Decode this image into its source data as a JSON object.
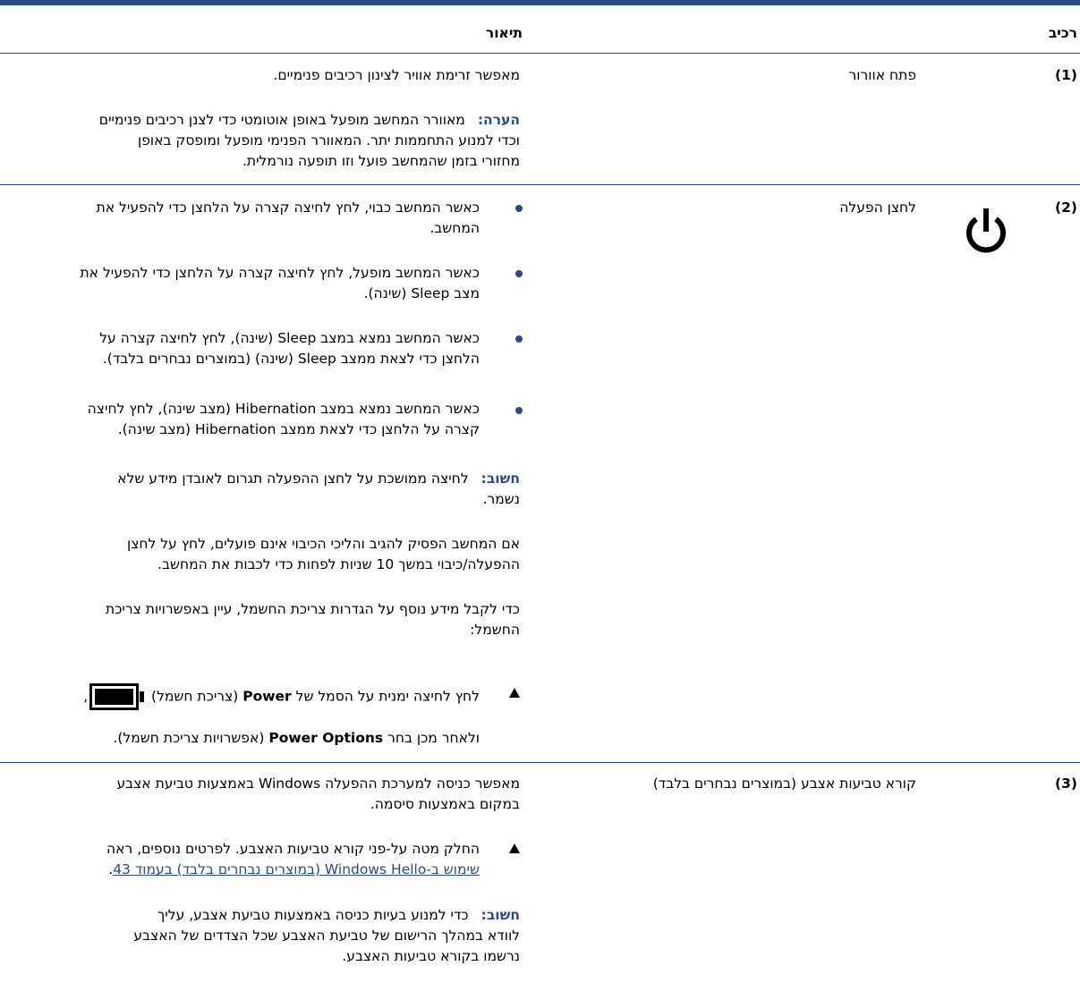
{
  "header": {
    "component": "רכיב",
    "description": "תיאור"
  },
  "rows": [
    {
      "number": "(1)",
      "name": "פתח אוורור",
      "desc": "מאפשר זרימת אוויר לצינון רכיבים פנימיים.",
      "note_label": "הערה:",
      "note_line1": "מאוורר המחשב מופעל באופן אוטומטי כדי לצנן רכיבים פנימיים",
      "note_line2": "וכדי למנוע התחממות יתר. המאוורר הפנימי מופעל ומופסק באופן",
      "note_line3": "מחזורי בזמן שהמחשב פועל וזו תופעה נורמלית."
    },
    {
      "number": "(2)",
      "name": "לחצן הפעלה",
      "icon": "power-icon",
      "bullets": [
        {
          "line1": "כאשר המחשב כבוי, לחץ לחיצה קצרה על הלחצן כדי להפעיל את",
          "line2": "המחשב."
        },
        {
          "line1": "כאשר המחשב מופעל, לחץ לחיצה קצרה על הלחצן כדי להפעיל את",
          "line2": "מצב Sleep (שינה)."
        },
        {
          "line1": "כאשר המחשב נמצא במצב Sleep (שינה), לחץ לחיצה קצרה על",
          "line2": "הלחצן כדי לצאת ממצב Sleep (שינה) (במוצרים נבחרים בלבד)."
        },
        {
          "line1": "כאשר המחשב נמצא במצב Hibernation (מצב שינה), לחץ לחיצה",
          "line2": "קצרה על הלחצן כדי לצאת ממצב Hibernation (מצב שינה)."
        }
      ],
      "important_label": "חשוב:",
      "important_line1": "לחיצה ממושכת על לחצן ההפעלה תגרום לאובדן מידע שלא",
      "important_line2": "נשמר.",
      "para1_line1": "אם המחשב הפסיק להגיב והליכי הכיבוי אינם פועלים, לחץ על לחצן",
      "para1_line2": "ההפעלה/כיבוי במשך 10 שניות לפחות כדי לכבות את המחשב.",
      "para2_line1": "כדי לקבל מידע נוסף על הגדרות צריכת החשמל, עיין באפשרויות צריכת",
      "para2_line2": "החשמל:",
      "step_pre": "לחץ לחיצה ימנית על הסמל של",
      "step_bold": "Power",
      "step_post": "(צריכת חשמל)",
      "step_icon": "battery-icon",
      "step_comma": ",",
      "step2_pre": "ולאחר מכן בחר",
      "step2_bold": "Power Options",
      "step2_post": "(אפשרויות צריכת חשמל)."
    },
    {
      "number": "(3)",
      "name": "קורא טביעות אצבע (במוצרים נבחרים בלבד)",
      "desc_line1": "מאפשר כניסה למערכת ההפעלה Windows באמצעות טביעת אצבע",
      "desc_line2": "במקום באמצעות סיסמה.",
      "step_line1": "החלק מטה על-פני קורא טביעות האצבע. לפרטים נוספים, ראה",
      "step_link": "שימוש ב-Windows Hello (במוצרים נבחרים בלבד) בעמוד 43",
      "step_link_end": ".",
      "important_label": "חשוב:",
      "important_line1": "כדי למנוע בעיות כניסה באמצעות טביעת אצבע, עליך",
      "important_line2": "לוודא במהלך הרישום של טביעת האצבע שכל הצדדים של האצבע",
      "important_line3": "נרשמו בקורא טביעות האצבע."
    }
  ],
  "colors": {
    "accent": "#2b4a8b",
    "text": "#000000"
  }
}
